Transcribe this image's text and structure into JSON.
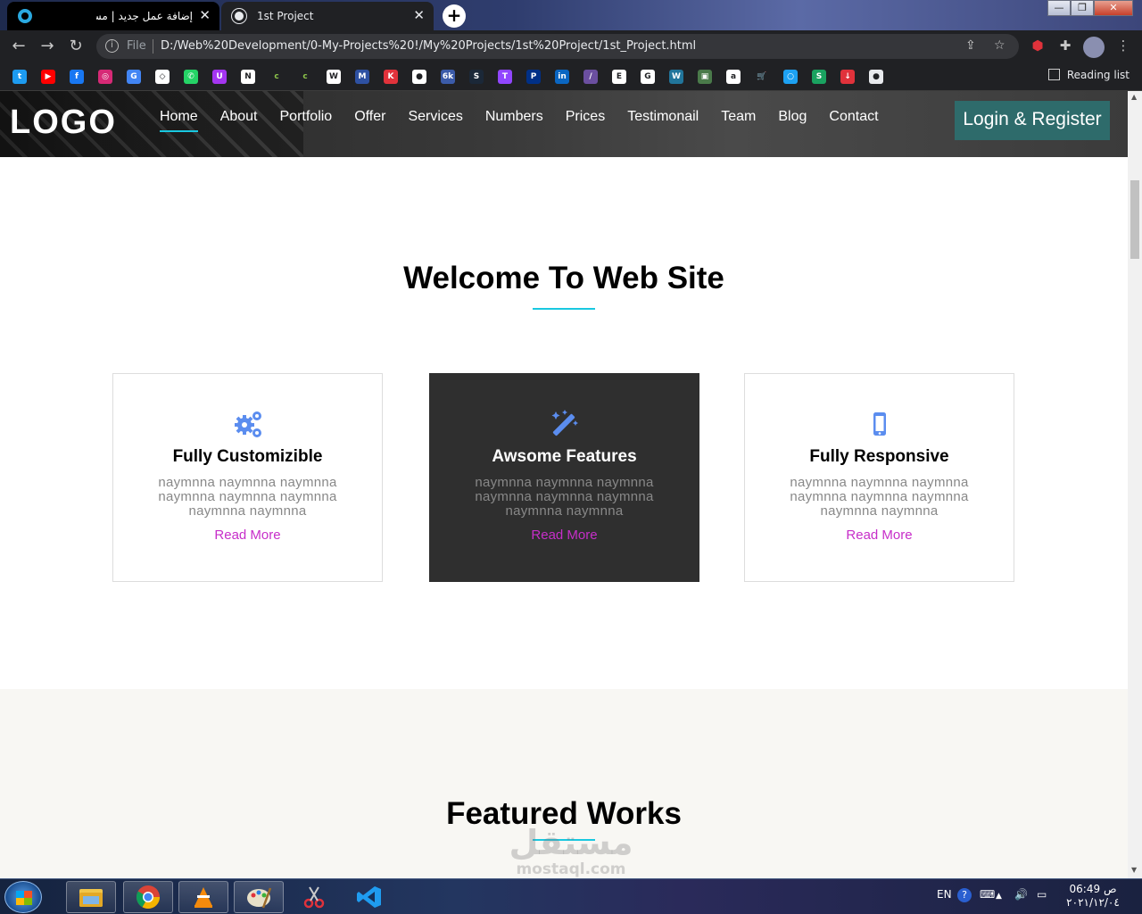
{
  "browser": {
    "tabs": [
      {
        "title": "إضافة عمل جديد | مستقل",
        "close": "✕"
      },
      {
        "title": "1st Project",
        "close": "✕"
      }
    ],
    "new_tab": "+",
    "window_controls": {
      "minimize": "—",
      "maximize": "❐",
      "close": "✕"
    },
    "address": {
      "scheme_label": "File",
      "url": "D:/Web%20Development/0-My-Projects%20!/My%20Projects/1st%20Project/1st_Project.html"
    },
    "reading_list": "Reading list",
    "bookmarks": [
      {
        "icon": "twitter-icon",
        "color": "#1d9bf0",
        "glyph": "t"
      },
      {
        "icon": "youtube-icon",
        "color": "#ff0000",
        "glyph": "▶"
      },
      {
        "icon": "facebook-icon",
        "color": "#1877f2",
        "glyph": "f"
      },
      {
        "icon": "instagram-icon",
        "color": "#d62976",
        "glyph": "◎"
      },
      {
        "icon": "translate-icon",
        "color": "#4285f4",
        "glyph": "G"
      },
      {
        "icon": "codepen-icon",
        "color": "#ffffff",
        "glyph": "◇"
      },
      {
        "icon": "whatsapp-icon",
        "color": "#25d366",
        "glyph": "✆"
      },
      {
        "icon": "udemy-icon",
        "color": "#a435f0",
        "glyph": "U"
      },
      {
        "icon": "notion-icon",
        "color": "#ffffff",
        "glyph": "N"
      },
      {
        "icon": "coursera-icon",
        "color": "#202124",
        "glyph": "c"
      },
      {
        "icon": "codecademy-icon",
        "color": "#202124",
        "glyph": "c"
      },
      {
        "icon": "wix-icon",
        "color": "#ffffff",
        "glyph": "W"
      },
      {
        "icon": "mal-icon",
        "color": "#2e51a2",
        "glyph": "M"
      },
      {
        "icon": "k-icon",
        "color": "#e0323b",
        "glyph": "K"
      },
      {
        "icon": "github-icon",
        "color": "#ffffff",
        "glyph": "●"
      },
      {
        "icon": "6k-icon",
        "color": "#3b5ba9",
        "glyph": "6k"
      },
      {
        "icon": "steam-icon",
        "color": "#1b2838",
        "glyph": "S"
      },
      {
        "icon": "twitch-icon",
        "color": "#9146ff",
        "glyph": "T"
      },
      {
        "icon": "paypal-icon",
        "color": "#003087",
        "glyph": "P"
      },
      {
        "icon": "linkedin-icon",
        "color": "#0a66c2",
        "glyph": "in"
      },
      {
        "icon": "feather-icon",
        "color": "#6b4fa0",
        "glyph": "/"
      },
      {
        "icon": "egybest-icon",
        "color": "#ffffff",
        "glyph": "E"
      },
      {
        "icon": "google-icon",
        "color": "#ffffff",
        "glyph": "G"
      },
      {
        "icon": "wordpress-icon",
        "color": "#21759b",
        "glyph": "W"
      },
      {
        "icon": "image-icon",
        "color": "#4a7a4a",
        "glyph": "▣"
      },
      {
        "icon": "amazon-icon",
        "color": "#ffffff",
        "glyph": "a"
      },
      {
        "icon": "cart-icon",
        "color": "#202124",
        "glyph": "🛒"
      },
      {
        "icon": "circle-icon",
        "color": "#1da1f2",
        "glyph": "○"
      },
      {
        "icon": "s-icon",
        "color": "#1aa260",
        "glyph": "S"
      },
      {
        "icon": "download-icon",
        "color": "#e0323b",
        "glyph": "↓"
      },
      {
        "icon": "globe-icon",
        "color": "#e8eaed",
        "glyph": "●"
      }
    ]
  },
  "site": {
    "logo": "LOGO",
    "nav": [
      "Home",
      "About",
      "Portfolio",
      "Offer",
      "Services",
      "Numbers",
      "Prices",
      "Testimonail",
      "Team",
      "Blog",
      "Contact"
    ],
    "login": "Login & Register",
    "welcome_title": "Welcome To Web Site",
    "cards": [
      {
        "icon": "gears-icon",
        "title": "Fully Customizible",
        "text": "naymnna naymnna naymnna naymnna naymnna naymnna naymnna naymnna",
        "link": "Read More"
      },
      {
        "icon": "magic-wand-icon",
        "title": "Awsome Features",
        "text": "naymnna naymnna naymnna naymnna naymnna naymnna naymnna naymnna",
        "link": "Read More"
      },
      {
        "icon": "mobile-icon",
        "title": "Fully Responsive",
        "text": "naymnna naymnna naymnna naymnna naymnna naymnna naymnna naymnna",
        "link": "Read More"
      },
      {}
    ],
    "featured_title": "Featured Works",
    "colors": {
      "accent": "#19c8e0",
      "link": "#c72ec9",
      "icon": "#5b8def",
      "dark_card": "#2f2f2f",
      "login_bg": "#2e6b6b"
    }
  },
  "watermark": {
    "arabic": "مستقل",
    "latin": "mostaql.com"
  },
  "taskbar": {
    "apps": [
      "explorer-icon",
      "chrome-icon",
      "vlc-icon",
      "paint-icon",
      "snipping-icon",
      "vscode-icon"
    ],
    "lang": "EN",
    "time": "06:49 ص",
    "date": "٢٠٢١/١٢/٠٤"
  }
}
